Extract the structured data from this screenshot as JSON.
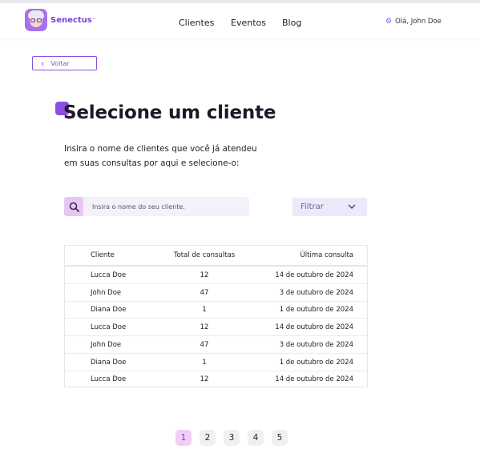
{
  "header": {
    "brand": "Senectus",
    "brand_tm": "™",
    "nav": [
      "Clientes",
      "Eventos",
      "Blog"
    ],
    "greeting": "Olá, John Doe"
  },
  "back_label": "Voltar",
  "title": "Selecione um cliente",
  "subtitle_line1": "Insira o nome de clientes que você já atendeu",
  "subtitle_line2": "em suas consultas por aqui e selecione-o:",
  "search": {
    "placeholder": "Insira o nome do seu cliente."
  },
  "filter": {
    "label": "Filtrar"
  },
  "table": {
    "columns": [
      "Cliente",
      "Total de consultas",
      "Última consulta"
    ],
    "rows": [
      [
        "Lucca Doe",
        "12",
        "14 de outubro de 2024"
      ],
      [
        "John Doe",
        "47",
        "3 de outubro de 2024"
      ],
      [
        "Diana Doe",
        "1",
        "1 de outubro de 2024"
      ],
      [
        "Lucca Doe",
        "12",
        "14 de outubro de 2024"
      ],
      [
        "John Doe",
        "47",
        "3 de outubro de 2024"
      ],
      [
        "Diana Doe",
        "1",
        "1 de outubro de 2024"
      ],
      [
        "Lucca Doe",
        "12",
        "14 de outubro de 2024"
      ]
    ]
  },
  "pagination": {
    "pages": [
      "1",
      "2",
      "3",
      "4",
      "5"
    ],
    "current": "1"
  },
  "colors": {
    "accent": "#8a4fe0",
    "page_active_bg": "#f2cdf6",
    "search_icon_bg": "#e6c7f4",
    "filter_bg": "#ede9fb"
  }
}
